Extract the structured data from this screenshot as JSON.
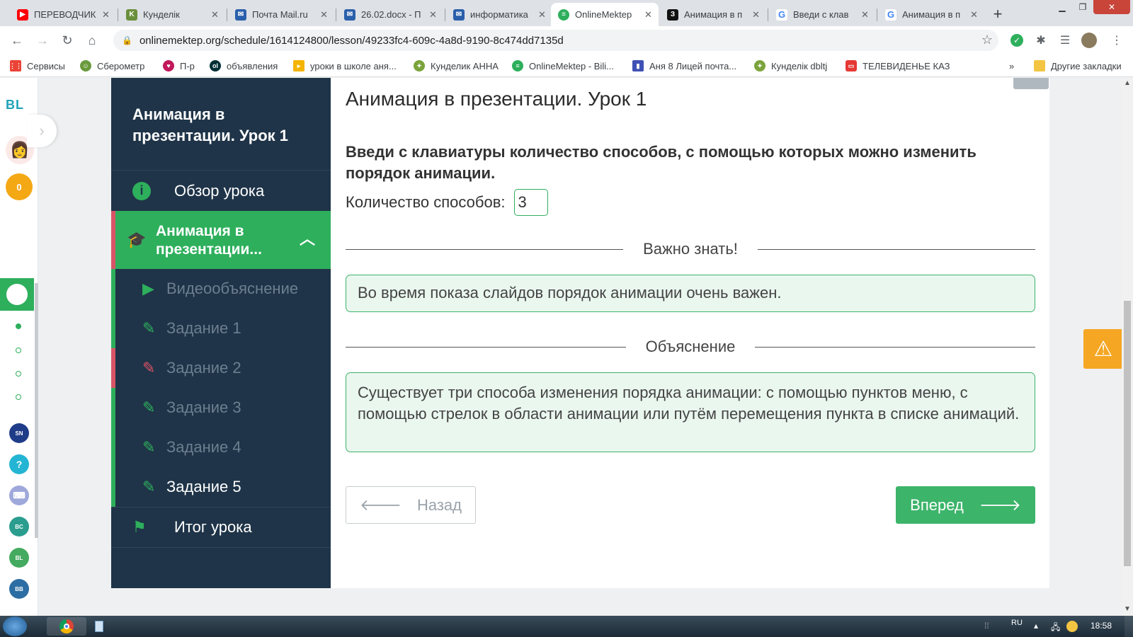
{
  "browser": {
    "tabs": [
      {
        "title": "ПЕРЕВОДЧИК",
        "icon": "youtube-icon",
        "color": "#ff0000"
      },
      {
        "title": "Кунделік",
        "icon": "kundelik-icon",
        "color": "#6a8f3c"
      },
      {
        "title": "Почта Mail.ru",
        "icon": "mail-icon",
        "color": "#2a5fab"
      },
      {
        "title": "26.02.docx - П",
        "icon": "mail-icon",
        "color": "#2a5fab"
      },
      {
        "title": "информатика",
        "icon": "mail-icon",
        "color": "#2a5fab"
      },
      {
        "title": "OnlineMektep",
        "icon": "onlinemektep-icon",
        "color": "#2eaf5c",
        "active": true
      },
      {
        "title": "Анимация в п",
        "icon": "znanija-icon",
        "color": "#111111"
      },
      {
        "title": "Введи с клав",
        "icon": "google-icon",
        "color": "#4285f4"
      },
      {
        "title": "Анимация в п",
        "icon": "google-icon",
        "color": "#4285f4"
      }
    ],
    "url": "onlinemektep.org/schedule/1614124800/lesson/49233fc4-609c-4a8d-9190-8c474dd7135d",
    "bookmarks": [
      {
        "label": "Сервисы",
        "icon": "apps-grid-icon"
      },
      {
        "label": "Сберометр",
        "icon": "sberometr-icon"
      },
      {
        "label": "П-р",
        "icon": "bookmark-icon"
      },
      {
        "label": "объявления",
        "icon": "olx-icon"
      },
      {
        "label": "уроки в школе аня...",
        "icon": "bookmark-icon"
      },
      {
        "label": "Кунделик АННА",
        "icon": "kundelik-icon"
      },
      {
        "label": "OnlineMektep - Bili...",
        "icon": "onlinemektep-icon"
      },
      {
        "label": "Аня 8 Лицей почта...",
        "icon": "chart-icon"
      },
      {
        "label": "Кунделік dbltj",
        "icon": "kundelik-icon"
      },
      {
        "label": "ТЕЛЕВИДЕНЬЕ КАЗ",
        "icon": "tv-icon"
      }
    ],
    "other_bookmarks": "Другие закладки"
  },
  "sidebar": {
    "logo": "BL",
    "coins": "0"
  },
  "lesson_nav": {
    "title": "Анимация в презентации. Урок 1",
    "overview": "Обзор урока",
    "section": "Анимация в презентации...",
    "items": [
      "Видеообъяснение",
      "Задание 1",
      "Задание 2",
      "Задание 3",
      "Задание 4",
      "Задание 5"
    ],
    "summary": "Итог урока"
  },
  "main": {
    "title": "Анимация в презентации. Урок 1",
    "question": "Введи с клавиатуры количество способов, с помощью которых можно изменить порядок анимации.",
    "answer_label": "Количество способов:",
    "answer_value": "3",
    "important_heading": "Важно знать!",
    "important_text": "Во время показа слайдов порядок анимации очень важен.",
    "explanation_heading": "Объяснение",
    "explanation_text": "Существует три способа изменения порядка анимации: с помощью пунктов меню, с помощью стрелок в области анимации или путём перемещения пункта в списке анимаций.",
    "back_label": "Назад",
    "next_label": "Вперед"
  },
  "taskbar": {
    "lang": "RU",
    "time": "18:58"
  },
  "colors": {
    "accent_green": "#2eaf5c",
    "nav_dark": "#1f3448",
    "error_red": "#d85466",
    "warn_orange": "#f5a623"
  }
}
